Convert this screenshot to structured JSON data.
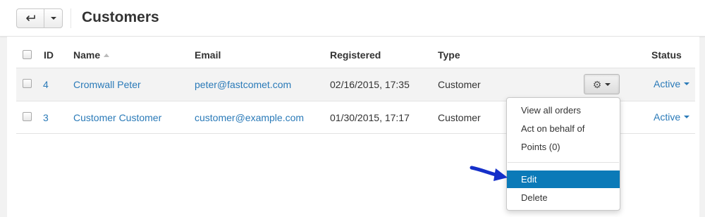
{
  "header": {
    "title": "Customers",
    "back_button_icon": "back-arrow-icon",
    "menu_caret_icon": "chevron-down-icon"
  },
  "table": {
    "columns": {
      "id": "ID",
      "name": "Name",
      "email": "Email",
      "registered": "Registered",
      "type": "Type",
      "status": "Status"
    },
    "sorted_by": "name",
    "rows": [
      {
        "id": "4",
        "name": "Cromwall Peter",
        "email": "peter@fastcomet.com",
        "registered": "02/16/2015, 17:35",
        "type": "Customer",
        "status": "Active"
      },
      {
        "id": "3",
        "name": "Customer Customer",
        "email": "customer@example.com",
        "registered": "01/30/2015, 17:17",
        "type": "Customer",
        "status": "Active"
      }
    ]
  },
  "actions_menu": {
    "button_icon": "gear-icon",
    "items": [
      "View all orders",
      "Act on behalf of",
      "Points (0)",
      "Edit",
      "Delete"
    ],
    "highlighted_item": "Edit"
  },
  "colors": {
    "link": "#2a7ab8",
    "highlight": "#0b7ab8",
    "pointer": "#1530c9"
  }
}
